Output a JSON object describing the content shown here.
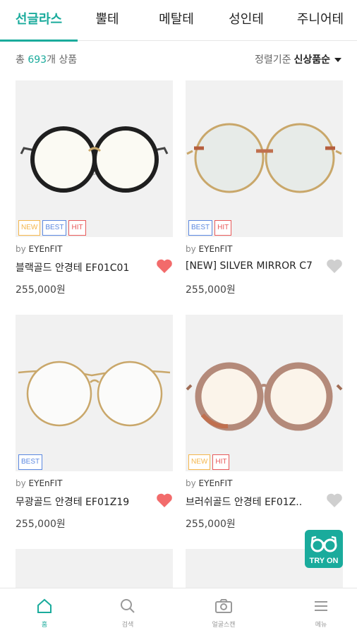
{
  "tabs": [
    {
      "label": "선글라스",
      "active": true
    },
    {
      "label": "뿔테",
      "active": false
    },
    {
      "label": "메탈테",
      "active": false
    },
    {
      "label": "성인테",
      "active": false
    },
    {
      "label": "주니어테",
      "active": false
    }
  ],
  "summary": {
    "prefix": "총 ",
    "count": "693",
    "suffix": "개 상품"
  },
  "sort": {
    "label": "정렬기준",
    "value": "신상품순"
  },
  "products": [
    {
      "brand_prefix": "by ",
      "brand": "EYEnFIT",
      "name": "블랙골드 안경테 EF01C01",
      "price": "255,000원",
      "badges": [
        "NEW",
        "BEST",
        "HIT"
      ],
      "liked": true
    },
    {
      "brand_prefix": "by ",
      "brand": "EYEnFIT",
      "name": "[NEW] SILVER MIRROR C7",
      "price": "255,000원",
      "badges": [
        "BEST",
        "HIT"
      ],
      "liked": false
    },
    {
      "brand_prefix": "by ",
      "brand": "EYEnFIT",
      "name": "무광골드 안경테 EF01Z19",
      "price": "255,000원",
      "badges": [
        "BEST"
      ],
      "liked": true
    },
    {
      "brand_prefix": "by ",
      "brand": "EYEnFIT",
      "name": "브러쉬골드 안경테 EF01Z..",
      "price": "255,000원",
      "badges": [
        "NEW",
        "HIT"
      ],
      "liked": false
    }
  ],
  "try_on": {
    "label": "TRY ON",
    "icon": "glasses-icon"
  },
  "bottom_nav": [
    {
      "label": "홈",
      "icon": "home-icon",
      "active": true
    },
    {
      "label": "검색",
      "icon": "search-icon",
      "active": false
    },
    {
      "label": "얼굴스캔",
      "icon": "camera-icon",
      "active": false
    },
    {
      "label": "메뉴",
      "icon": "menu-icon",
      "active": false
    }
  ],
  "colors": {
    "accent": "#1aab9c",
    "heart_active": "#f26b6b",
    "heart_inactive": "#cfcfcf",
    "badge_new": "#f4b64c",
    "badge_best": "#5b88e0",
    "badge_hit": "#e85a5a"
  }
}
